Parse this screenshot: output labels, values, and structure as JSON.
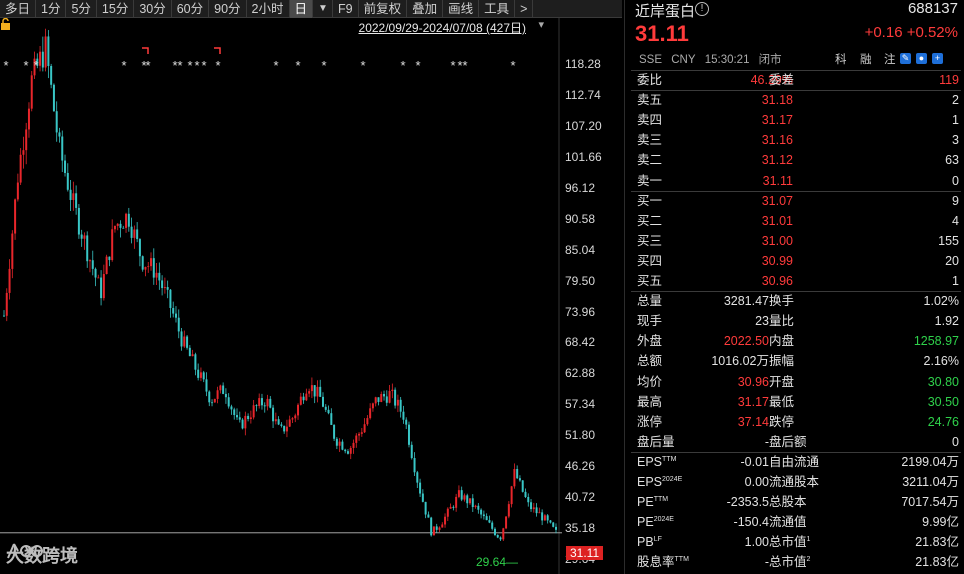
{
  "toolbar": {
    "items": [
      "多日",
      "1分",
      "5分",
      "15分",
      "30分",
      "60分",
      "90分",
      "2小时",
      "日",
      "▼",
      "F9",
      "前复权",
      "叠加",
      "画线",
      "工具",
      ">"
    ],
    "active": "日"
  },
  "chart": {
    "range_label": "2022/09/29-2024/07/08 (427日)",
    "y_ticks": [
      "118.28",
      "112.74",
      "107.20",
      "101.66",
      "96.12",
      "90.58",
      "85.04",
      "79.50",
      "73.96",
      "68.42",
      "62.88",
      "57.34",
      "51.80",
      "46.26",
      "40.72",
      "35.18",
      "29.64"
    ],
    "last_price_tag": "31.11",
    "low_label": "29.64—",
    "watermark": "大数跨境",
    "marker_glyph": "*",
    "colors": {
      "up": "#e8262b",
      "down": "#39c6c6",
      "background": "#000000"
    }
  },
  "chart_data": {
    "type": "candlestick",
    "date_range": [
      "2022/09/29",
      "2024/07/08"
    ],
    "bars": 427,
    "ylim": [
      29.64,
      118.28
    ],
    "last_close": 31.11,
    "period_low": 29.64,
    "close_path_approx": [
      70,
      95,
      112,
      118,
      100,
      90,
      82,
      74,
      86,
      88,
      80,
      78,
      72,
      65,
      60,
      55,
      57,
      50,
      53,
      55,
      49,
      52,
      58,
      55,
      48,
      46,
      50,
      55,
      56,
      52,
      40,
      31,
      34,
      38,
      36,
      33,
      30,
      42,
      36,
      34,
      31.11
    ]
  },
  "panel": {
    "name": "近岸蛋白",
    "code": "688137",
    "price": "31.11",
    "change": "+0.16 +0.52%",
    "meta": [
      "SSE",
      "CNY",
      "15:30:21",
      "闭市"
    ],
    "flags": [
      "科",
      "融",
      "注"
    ],
    "weibi": {
      "label": "委比",
      "value": "46.29%",
      "label2": "委差",
      "value2": "119"
    },
    "asks": [
      {
        "label": "卖五",
        "price": "31.18",
        "vol": "2"
      },
      {
        "label": "卖四",
        "price": "31.17",
        "vol": "1"
      },
      {
        "label": "卖三",
        "price": "31.16",
        "vol": "3"
      },
      {
        "label": "卖二",
        "price": "31.12",
        "vol": "63"
      },
      {
        "label": "卖一",
        "price": "31.11",
        "vol": "0"
      }
    ],
    "bids": [
      {
        "label": "买一",
        "price": "31.07",
        "vol": "9"
      },
      {
        "label": "买二",
        "price": "31.01",
        "vol": "4"
      },
      {
        "label": "买三",
        "price": "31.00",
        "vol": "155"
      },
      {
        "label": "买四",
        "price": "30.99",
        "vol": "20"
      },
      {
        "label": "买五",
        "price": "30.96",
        "vol": "1"
      }
    ],
    "stats": [
      {
        "l1": "总量",
        "v1": "3281.47",
        "c1": "white",
        "l2": "换手",
        "v2": "1.02%",
        "c2": "white"
      },
      {
        "l1": "现手",
        "v1": "23",
        "c1": "white",
        "l2": "量比",
        "v2": "1.92",
        "c2": "white"
      },
      {
        "l1": "外盘",
        "v1": "2022.50",
        "c1": "red",
        "l2": "内盘",
        "v2": "1258.97",
        "c2": "green"
      },
      {
        "l1": "总额",
        "v1": "1016.02万",
        "c1": "white",
        "l2": "振幅",
        "v2": "2.16%",
        "c2": "white"
      },
      {
        "l1": "均价",
        "v1": "30.96",
        "c1": "red",
        "l2": "开盘",
        "v2": "30.80",
        "c2": "green"
      },
      {
        "l1": "最高",
        "v1": "31.17",
        "c1": "red",
        "l2": "最低",
        "v2": "30.50",
        "c2": "green"
      },
      {
        "l1": "涨停",
        "v1": "37.14",
        "c1": "red",
        "l2": "跌停",
        "v2": "24.76",
        "c2": "green"
      },
      {
        "l1": "盘后量",
        "v1": "-",
        "c1": "white",
        "l2": "盘后额",
        "v2": "0",
        "c2": "white"
      }
    ],
    "fund": [
      {
        "l1": "EPS",
        "s1": "TTM",
        "v1": "-0.01",
        "l2": "自由流通",
        "s2": "",
        "v2": "2199.04万"
      },
      {
        "l1": "EPS",
        "s1": "2024E",
        "v1": "0.00",
        "l2": "流通股本",
        "s2": "",
        "v2": "3211.04万"
      },
      {
        "l1": "PE",
        "s1": "TTM",
        "v1": "-2353.5",
        "l2": "总股本",
        "s2": "",
        "v2": "7017.54万"
      },
      {
        "l1": "PE",
        "s1": "2024E",
        "v1": "-150.4",
        "l2": "流通值",
        "s2": "",
        "v2": "9.99亿"
      },
      {
        "l1": "PB",
        "s1": "LF",
        "v1": "1.00",
        "l2": "总市值",
        "s2": "1",
        "v2": "21.83亿"
      },
      {
        "l1": "股息率",
        "s1": "TTM",
        "v1": "-",
        "l2": "总市值",
        "s2": "2",
        "v2": "21.83亿"
      }
    ]
  }
}
